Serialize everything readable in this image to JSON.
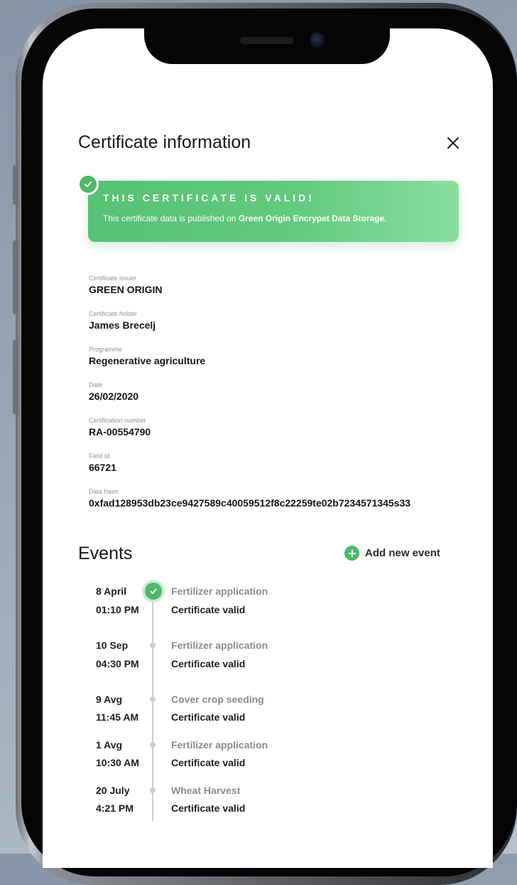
{
  "modal": {
    "title": "Certificate information"
  },
  "banner": {
    "heading": "THIS CERTIFICATE IS VALID!",
    "text_prefix": "This certificate data is published on ",
    "text_strong": "Green Origin Encrypet Data Storage."
  },
  "fields": [
    {
      "label": "Certificate issuer",
      "value": "GREEN ORIGIN"
    },
    {
      "label": "Certificate holder",
      "value": "James Brecelj"
    },
    {
      "label": "Programme",
      "value": "Regenerative agriculture"
    },
    {
      "label": "Date",
      "value": "26/02/2020"
    },
    {
      "label": "Certification number",
      "value": "RA-00554790"
    },
    {
      "label": "Field Id",
      "value": "66721"
    },
    {
      "label": "Data hash",
      "value": "0xfad128953db23ce9427589c40059512f8c22259te02b7234571345s33"
    }
  ],
  "events": {
    "title": "Events",
    "add_label": "Add new event",
    "items": [
      {
        "date": "8 April",
        "time": "01:10 PM",
        "name": "Fertilizer application",
        "status": "Certificate valid"
      },
      {
        "date": "10 Sep",
        "time": "04:30 PM",
        "name": "Fertilizer application",
        "status": "Certificate valid"
      },
      {
        "date": "9 Avg",
        "time": "11:45 AM",
        "name": "Cover crop seeding",
        "status": "Certificate valid"
      },
      {
        "date": "1 Avg",
        "time": "10:30 AM",
        "name": "Fertilizer application",
        "status": "Certificate valid"
      },
      {
        "date": "20 July",
        "time": "4:21 PM",
        "name": "Wheat Harvest",
        "status": "Certificate valid"
      }
    ]
  },
  "colors": {
    "accent_green": "#4eb868",
    "banner_gradient_start": "#56c074",
    "banner_gradient_end": "#8adf9e",
    "timeline_gray": "#c9ced6"
  },
  "icons": {
    "close": "close-icon",
    "valid": "check-circle-icon",
    "add": "plus-circle-icon"
  }
}
